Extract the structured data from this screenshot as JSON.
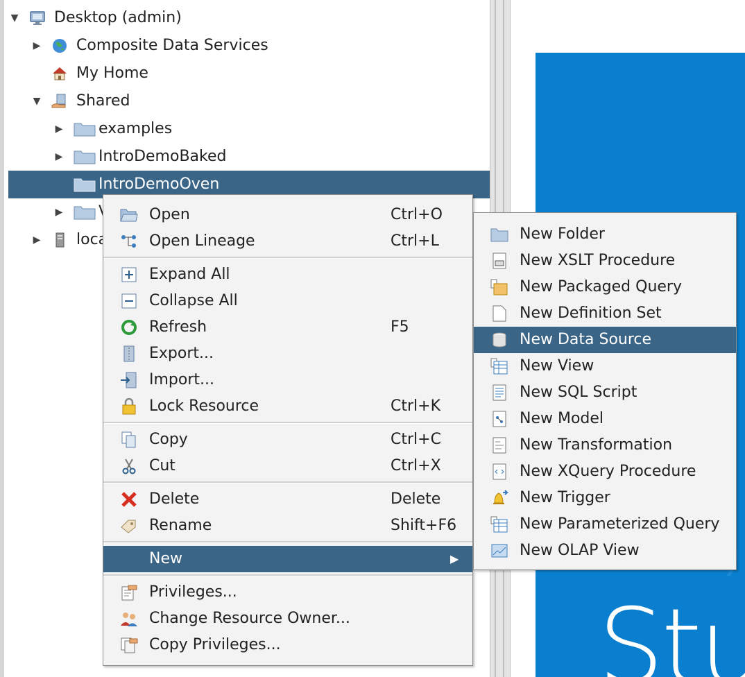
{
  "tree": {
    "nodes": [
      {
        "label": "Desktop (admin)",
        "icon": "monitor-icon",
        "expanded": true
      },
      {
        "label": "Composite Data Services",
        "icon": "globe-icon",
        "expanded": false
      },
      {
        "label": "My Home",
        "icon": "home-icon"
      },
      {
        "label": "Shared",
        "icon": "shared-hand-icon",
        "expanded": true
      },
      {
        "label": "examples",
        "icon": "folder-icon",
        "expanded": false
      },
      {
        "label": "IntroDemoBaked",
        "icon": "folder-icon",
        "expanded": false
      },
      {
        "label": "IntroDemoOven",
        "icon": "folder-icon",
        "selected": true
      },
      {
        "label": "V",
        "icon": "folder-icon",
        "expanded": false
      },
      {
        "label": "loca",
        "icon": "server-icon",
        "expanded": false
      }
    ]
  },
  "context_menu": {
    "items": [
      {
        "label": "Open",
        "accel": "Ctrl+O",
        "icon": "open-folder-icon"
      },
      {
        "label": "Open Lineage",
        "accel": "Ctrl+L",
        "icon": "lineage-icon"
      },
      {
        "label": "Expand All",
        "accel": "",
        "icon": "expand-icon"
      },
      {
        "label": "Collapse All",
        "accel": "",
        "icon": "collapse-icon"
      },
      {
        "label": "Refresh",
        "accel": "F5",
        "icon": "refresh-icon"
      },
      {
        "label": "Export...",
        "accel": "",
        "icon": "export-icon"
      },
      {
        "label": "Import...",
        "accel": "",
        "icon": "import-icon"
      },
      {
        "label": "Lock Resource",
        "accel": "Ctrl+K",
        "icon": "lock-icon"
      },
      {
        "label": "Copy",
        "accel": "Ctrl+C",
        "icon": "copy-icon"
      },
      {
        "label": "Cut",
        "accel": "Ctrl+X",
        "icon": "scissors-icon"
      },
      {
        "label": "Delete",
        "accel": "Delete",
        "icon": "delete-x-icon"
      },
      {
        "label": "Rename",
        "accel": "Shift+F6",
        "icon": "tag-icon"
      },
      {
        "label": "New",
        "accel": "",
        "icon": ""
      },
      {
        "label": "Privileges...",
        "accel": "",
        "icon": "privileges-icon"
      },
      {
        "label": "Change Resource Owner...",
        "accel": "",
        "icon": "owner-icon"
      },
      {
        "label": "Copy Privileges...",
        "accel": "",
        "icon": "copy-privileges-icon"
      }
    ],
    "submenu_arrow": "▶"
  },
  "new_submenu": {
    "items": [
      {
        "label": "New Folder",
        "icon": "folder-icon"
      },
      {
        "label": "New XSLT Procedure",
        "icon": "xslt-icon"
      },
      {
        "label": "New Packaged Query",
        "icon": "packaged-query-icon"
      },
      {
        "label": "New Definition Set",
        "icon": "document-icon"
      },
      {
        "label": "New Data Source",
        "icon": "database-icon",
        "highlighted": true
      },
      {
        "label": "New View",
        "icon": "view-icon"
      },
      {
        "label": "New SQL Script",
        "icon": "sql-script-icon"
      },
      {
        "label": "New Model",
        "icon": "model-icon"
      },
      {
        "label": "New Transformation",
        "icon": "transformation-icon"
      },
      {
        "label": "New XQuery Procedure",
        "icon": "xquery-icon"
      },
      {
        "label": "New Trigger",
        "icon": "bell-icon"
      },
      {
        "label": "New Parameterized Query",
        "icon": "param-query-icon"
      },
      {
        "label": "New OLAP View",
        "icon": "olap-icon"
      }
    ]
  },
  "splash": {
    "text": "Stu"
  },
  "colors": {
    "selection": "#3b6587",
    "splash_blue": "#0a7fcf",
    "menu_bg": "#f3f3f3"
  }
}
